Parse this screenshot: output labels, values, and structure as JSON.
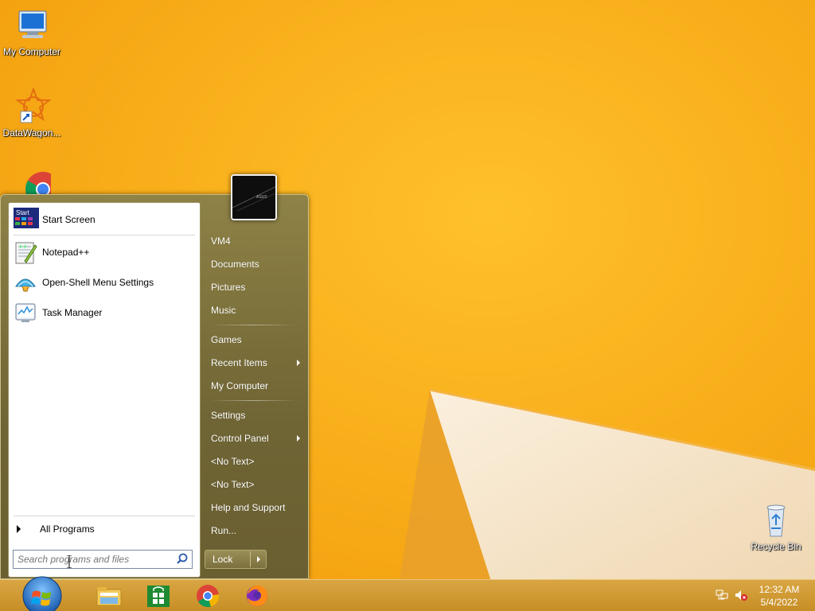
{
  "desktop": {
    "icons": [
      {
        "label": "My Computer",
        "icon": "computer-icon"
      },
      {
        "label": "DataWagon...",
        "icon": "datawagon-icon"
      },
      {
        "label": "",
        "icon": "chrome-icon"
      },
      {
        "label": "Recycle Bin",
        "icon": "recycle-bin-icon"
      }
    ]
  },
  "start_menu": {
    "pinned": [
      {
        "label": "Start Screen",
        "icon": "start-screen-icon"
      },
      {
        "label": "Notepad++",
        "icon": "notepadpp-icon"
      },
      {
        "label": "Open-Shell Menu Settings",
        "icon": "open-shell-icon"
      },
      {
        "label": "Task Manager",
        "icon": "task-manager-icon"
      }
    ],
    "start_screen_badge": "Start",
    "all_programs": "All Programs",
    "search_placeholder": "Search programs and files",
    "right_items": [
      {
        "label": "VM4",
        "submenu": false
      },
      {
        "label": "Documents",
        "submenu": false
      },
      {
        "label": "Pictures",
        "submenu": false
      },
      {
        "label": "Music",
        "submenu": false
      },
      {
        "label": "Games",
        "submenu": false
      },
      {
        "label": "Recent Items",
        "submenu": true
      },
      {
        "label": "My Computer",
        "submenu": false
      },
      {
        "label": "Settings",
        "submenu": false
      },
      {
        "label": "Control Panel",
        "submenu": true
      },
      {
        "label": "<No Text>",
        "submenu": false
      },
      {
        "label": "<No Text>",
        "submenu": false
      },
      {
        "label": "Help and Support",
        "submenu": false
      },
      {
        "label": "Run...",
        "submenu": false
      }
    ],
    "lock_label": "Lock",
    "user_picture_brand": "ASUS"
  },
  "taskbar": {
    "pinned": [
      "file-explorer-icon",
      "store-icon",
      "chrome-icon",
      "firefox-icon"
    ],
    "clock_time": "12:32 AM",
    "clock_date": "5/4/2022"
  },
  "colors": {
    "wallpaper": "#f6a70f",
    "menu_accent": "#7a6e3a",
    "taskbar": "#cf9a33"
  }
}
